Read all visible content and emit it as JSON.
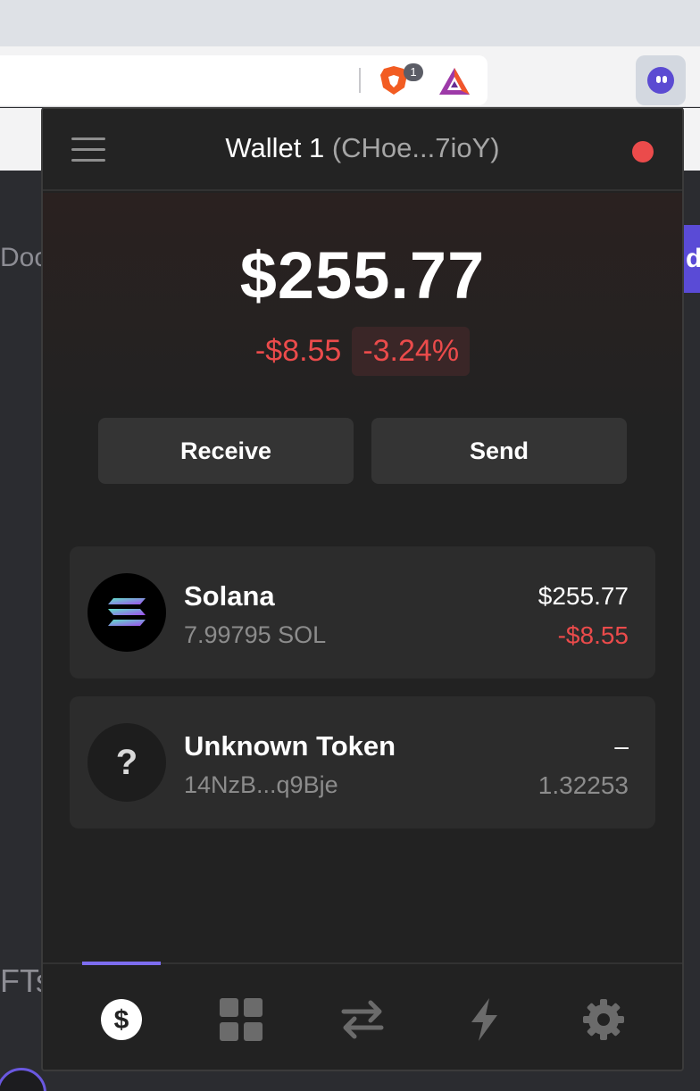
{
  "browser": {
    "extension_badge": "1",
    "icons": [
      "brave-shield-icon",
      "brave-rewards-icon",
      "phantom-extension-icon"
    ]
  },
  "background_page": {
    "left_text_1": "Doc",
    "left_text_2": "FTs",
    "right_button_letter": "d"
  },
  "wallet": {
    "name": "Wallet 1",
    "address": "(CHoe...7ioY)",
    "status_color": "#eb4b4b"
  },
  "balance": {
    "total": "$255.77",
    "change_usd": "-$8.55",
    "change_pct": "-3.24%"
  },
  "actions": {
    "receive_label": "Receive",
    "send_label": "Send"
  },
  "tokens": [
    {
      "name": "Solana",
      "amount": "7.99795 SOL",
      "value": "$255.77",
      "change": "-$8.55",
      "icon": "solana-logo-icon"
    },
    {
      "name": "Unknown Token",
      "amount": "14NzB...q9Bje",
      "value": "–",
      "change": "1.32253",
      "icon": "question-mark",
      "icon_glyph": "?"
    }
  ],
  "nav": {
    "items": [
      "tokens-tab",
      "collectibles-tab",
      "swap-tab",
      "activity-tab",
      "settings-tab"
    ],
    "active": "tokens-tab",
    "accent": "#7d6df0"
  },
  "colors": {
    "negative": "#eb4b4b",
    "popup_bg": "#222222",
    "card_bg": "#2c2c2c"
  }
}
